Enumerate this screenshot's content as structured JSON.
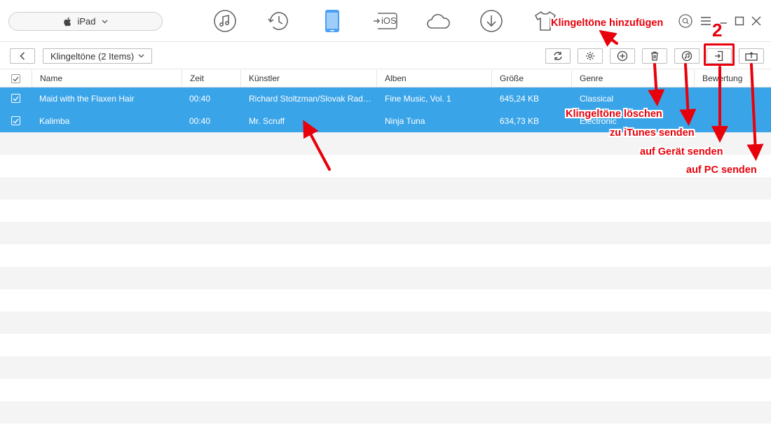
{
  "device": {
    "name": "iPad"
  },
  "nav_icons": [
    "music-icon",
    "history-icon",
    "device-icon",
    "to-ios-icon",
    "cloud-icon",
    "download-icon",
    "tshirt-icon"
  ],
  "nav_ios_label": "iOS",
  "window_controls": [
    "search-icon",
    "menu-icon",
    "minimize-icon",
    "maximize-icon",
    "close-icon"
  ],
  "breadcrumb": {
    "label": "Klingeltöne (2 Items)"
  },
  "toolbar": [
    "refresh-icon",
    "settings-icon",
    "add-icon",
    "delete-icon",
    "to-itunes-icon",
    "to-device-icon",
    "to-pc-icon"
  ],
  "table": {
    "columns": [
      "Name",
      "Zeit",
      "Künstler",
      "Alben",
      "Größe",
      "Genre",
      "Bewertung"
    ],
    "rows": [
      {
        "name": "Maid with the Flaxen Hair",
        "time": "00:40",
        "artist": "Richard Stoltzman/Slovak Radi...",
        "album": "Fine Music, Vol. 1",
        "size": "645,24 KB",
        "genre": "Classical",
        "checked": true
      },
      {
        "name": "Kalimba",
        "time": "00:40",
        "artist": "Mr. Scruff",
        "album": "Ninja Tuna",
        "size": "634,73 KB",
        "genre": "Electronic",
        "checked": true
      }
    ]
  },
  "annotations": {
    "add": "Klingeltöne hinzufügen",
    "delete": "Klingeltöne löschen",
    "itunes": "zu iTunes senden",
    "device": "auf Gerät senden",
    "pc": "auf PC senden",
    "step": "2"
  },
  "colors": {
    "selection": "#3aa4e8",
    "annotation": "#e8000b",
    "accent_icon": "#4a9ff5"
  }
}
